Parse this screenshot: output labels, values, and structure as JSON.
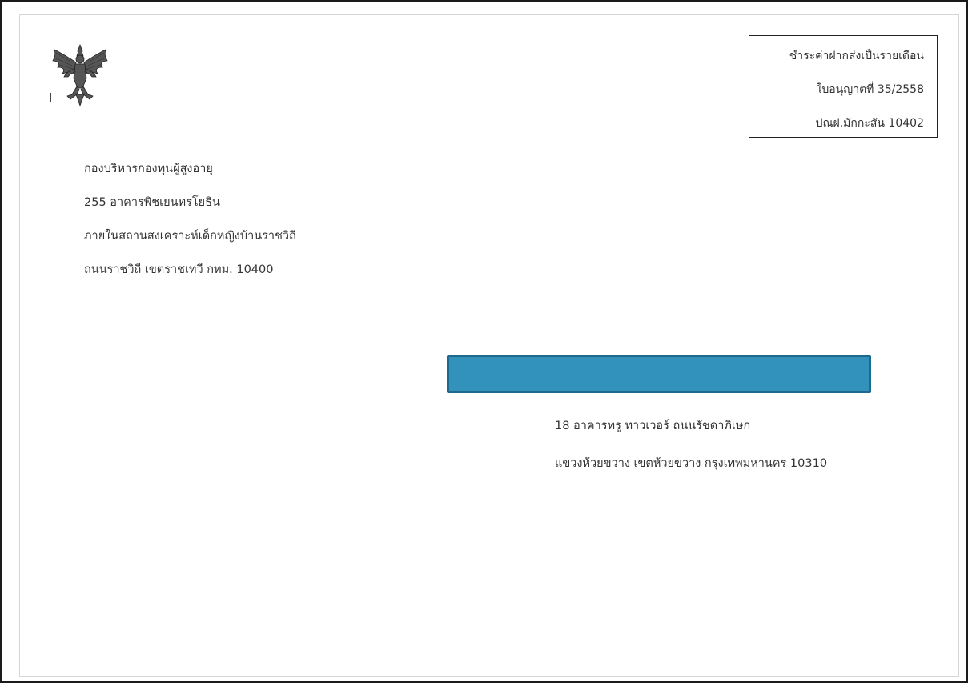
{
  "postage": {
    "line1": "ชำระค่าฝากส่งเป็นรายเดือน",
    "line2": "ใบอนุญาตที่ 35/2558",
    "line3": "ปณฝ.มักกะสัน 10402"
  },
  "sender": {
    "line1": "กองบริหารกองทุนผู้สูงอายุ",
    "line2": "255 อาคารพิชเยนทรโยธิน",
    "line3": "ภายในสถานสงเคราะห์เด็กหญิงบ้านราชวิถี",
    "line4": "ถนนราชวิถี เขตราชเทวี กทม. 10400"
  },
  "recipient": {
    "redacted_color": "#3292bb",
    "line1": "18 อาคารทรู ทาวเวอร์ ถนนรัชดาภิเษก",
    "line2": "แขวงห้วยขวาง เขตห้วยขวาง กรุงเทพมหานคร 10310"
  },
  "emblem": {
    "icon": "garuda-emblem-icon"
  }
}
